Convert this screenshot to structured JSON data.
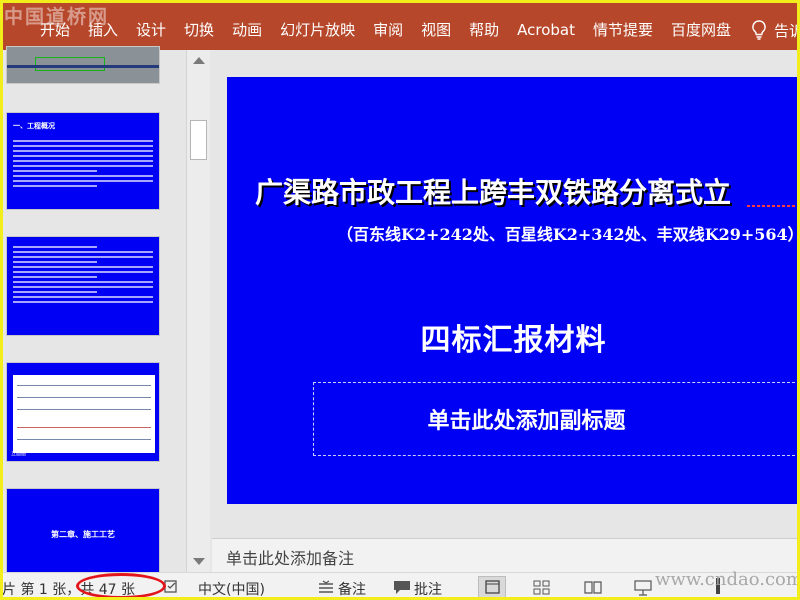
{
  "watermark_top": "中国道桥网",
  "watermark_bottom": "www.cndao.com",
  "ribbon": {
    "tabs": [
      "开始",
      "插入",
      "设计",
      "切换",
      "动画",
      "幻灯片放映",
      "审阅",
      "视图",
      "帮助",
      "Acrobat",
      "情节提要",
      "百度网盘"
    ],
    "tell_me": "告诉"
  },
  "thumbnails": {
    "slide2_title": "一、工程概况",
    "slide4_caption": "立面图",
    "slide5_title": "第二章、施工工艺"
  },
  "slide": {
    "title": "广渠路市政工程上跨丰双铁路分离式立",
    "subtitle": "（百东线K2+242处、百星线K2+342处、丰双线K29+564）",
    "heading": "四标汇报材料",
    "subtitle_placeholder": "单击此处添加副标题"
  },
  "notes_placeholder": "单击此处添加备注",
  "status": {
    "slide_info": "片 第 1 张，共 47 张",
    "language": "中文(中国)",
    "notes_button": "备注",
    "comments_button": "批注"
  },
  "colors": {
    "ribbon": "#b7472a",
    "slide_bg": "#0000f5",
    "frame": "#f2ee1c",
    "highlight_circle": "#e3151c"
  }
}
